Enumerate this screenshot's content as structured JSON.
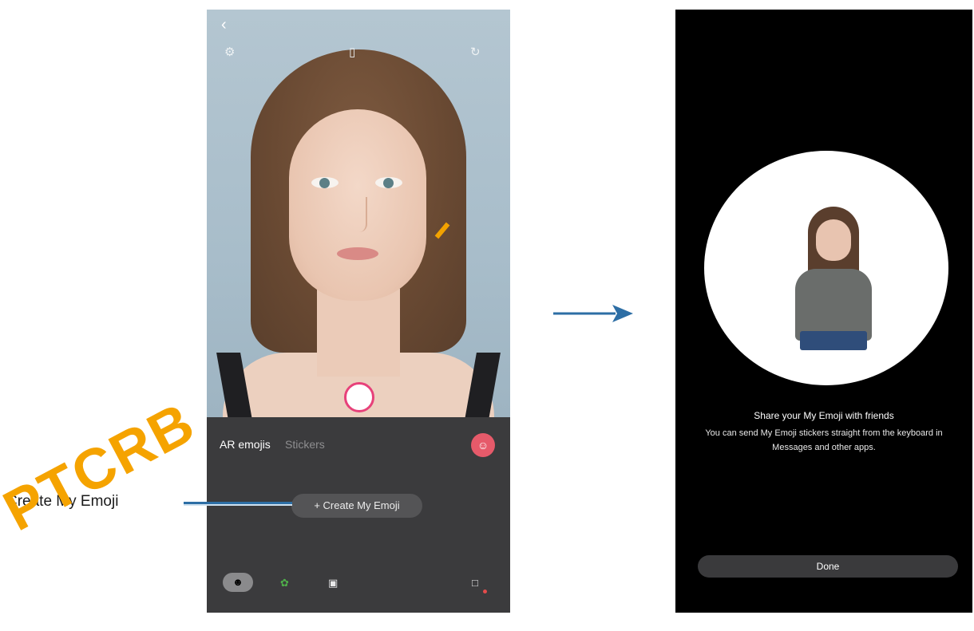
{
  "left_phone": {
    "back_icon": "chevron-left-icon",
    "top_icons": [
      "gear-icon",
      "battery-icon",
      "camera-switch-icon"
    ],
    "tabs": [
      {
        "label": "AR emojis",
        "active": true
      },
      {
        "label": "Stickers",
        "active": false
      }
    ],
    "create_button_label": "+ Create My Emoji",
    "shutter_color": "#e7417a",
    "bottom_icons": [
      "avatar-icon",
      "decorations-icon",
      "frame-icon",
      "store-icon"
    ]
  },
  "callout": {
    "label": "Create My Emoji",
    "line_color": "#2d6ea5"
  },
  "watermark": {
    "text": "PTCRB",
    "color": "#f5a300"
  },
  "arrow": {
    "color": "#2d6ea5"
  },
  "right_phone": {
    "title": "Share your My Emoji with friends",
    "body": "You can send My Emoji stickers straight from the keyboard in Messages and other apps.",
    "done_label": "Done"
  }
}
